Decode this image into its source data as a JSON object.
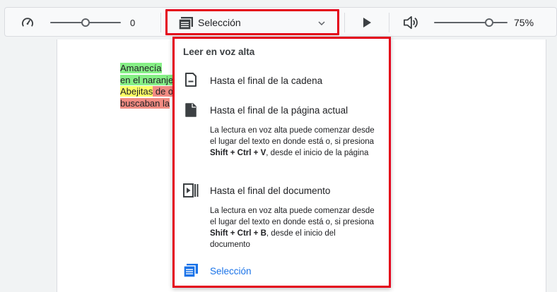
{
  "toolbar": {
    "speed_value": "0",
    "speed_level": 0.5,
    "mode_label": "Selección",
    "volume_value": "75%",
    "volume_level": 0.75
  },
  "document": {
    "lines": [
      {
        "parts": [
          {
            "text": "Amanecía",
            "hl": "green"
          }
        ]
      },
      {
        "parts": [
          {
            "text": "en el naranje",
            "hl": "green"
          }
        ]
      },
      {
        "parts": [
          {
            "text": "Abejitas",
            "hl": "yellow"
          },
          {
            "text": " de o",
            "hl": "red"
          }
        ]
      },
      {
        "parts": [
          {
            "text": "buscaban la",
            "hl": "red"
          }
        ]
      }
    ]
  },
  "menu": {
    "title": "Leer en voz alta",
    "items": [
      {
        "label": "Hasta el final de la cadena"
      },
      {
        "label": "Hasta el final de la página actual",
        "desc_a": "La lectura en voz alta puede comenzar desde el lugar del texto en donde está o, si presiona ",
        "desc_shortcut": "Shift + Ctrl + V",
        "desc_b": ", desde el inicio de la página"
      },
      {
        "label": "Hasta el final del documento",
        "desc_a": "La lectura en voz alta puede comenzar desde el lugar del texto en donde está o, si presiona ",
        "desc_shortcut": "Shift + Ctrl + B",
        "desc_b": ", desde el inicio del documento"
      },
      {
        "label": "Selección"
      }
    ]
  },
  "colors": {
    "highlight_border": "#e4001b",
    "accent": "#1a73e8",
    "hl_green": "#86ef86",
    "hl_yellow": "#ffff66",
    "hl_red": "#f28b82"
  },
  "icons": {
    "speed": "speedometer-icon",
    "mode": "document-lines-icon",
    "chevron": "chevron-down-icon",
    "play": "play-icon",
    "volume": "volume-icon",
    "item_0": "page-outline-icon",
    "item_1": "page-filled-icon",
    "item_2": "play-document-icon",
    "item_3": "selection-icon"
  }
}
